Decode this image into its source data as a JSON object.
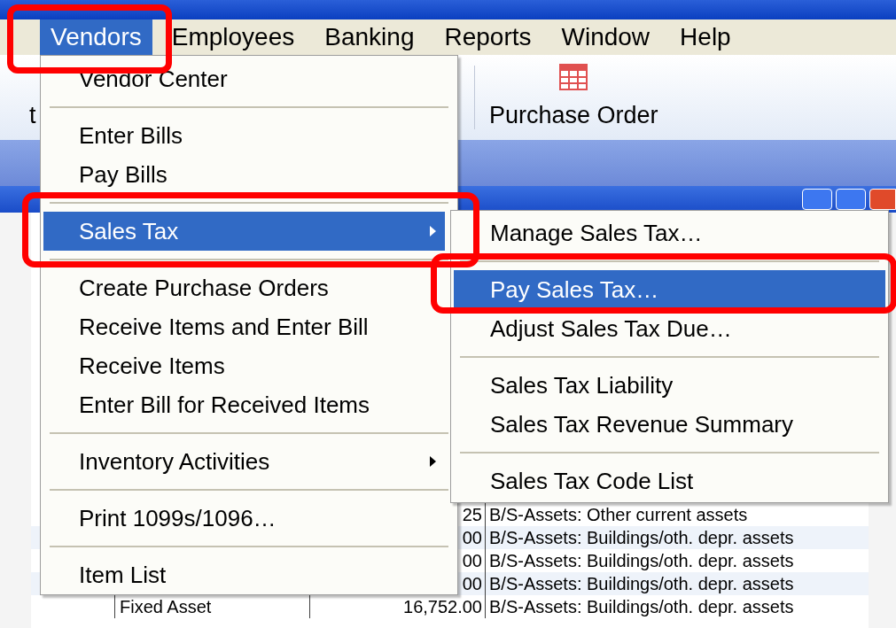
{
  "menu_bar": [
    {
      "label": "Vendors",
      "selected": true
    },
    {
      "label": "Employees",
      "selected": false
    },
    {
      "label": "Banking",
      "selected": false
    },
    {
      "label": "Reports",
      "selected": false
    },
    {
      "label": "Window",
      "selected": false
    },
    {
      "label": "Help",
      "selected": false
    }
  ],
  "toolbar": [
    {
      "label": "t",
      "kind": "text"
    },
    {
      "label": "Purchase Order",
      "kind": "icon"
    }
  ],
  "vendors_menu": [
    {
      "kind": "item",
      "label": "Vendor Center",
      "selected": false,
      "submenu": false
    },
    {
      "kind": "separator"
    },
    {
      "kind": "item",
      "label": "Enter Bills",
      "selected": false,
      "submenu": false
    },
    {
      "kind": "item",
      "label": "Pay Bills",
      "selected": false,
      "submenu": false
    },
    {
      "kind": "separator"
    },
    {
      "kind": "item",
      "label": "Sales Tax",
      "selected": true,
      "submenu": true
    },
    {
      "kind": "separator"
    },
    {
      "kind": "item",
      "label": "Create Purchase Orders",
      "selected": false,
      "submenu": false
    },
    {
      "kind": "item",
      "label": "Receive Items and Enter Bill",
      "selected": false,
      "submenu": false
    },
    {
      "kind": "item",
      "label": "Receive Items",
      "selected": false,
      "submenu": false
    },
    {
      "kind": "item",
      "label": "Enter Bill for Received Items",
      "selected": false,
      "submenu": false
    },
    {
      "kind": "separator"
    },
    {
      "kind": "item",
      "label": "Inventory Activities",
      "selected": false,
      "submenu": true
    },
    {
      "kind": "separator"
    },
    {
      "kind": "item",
      "label": "Print 1099s/1096…",
      "selected": false,
      "submenu": false
    },
    {
      "kind": "separator"
    },
    {
      "kind": "item",
      "label": "Item List",
      "selected": false,
      "submenu": false
    }
  ],
  "sales_tax_submenu": [
    {
      "kind": "item",
      "label": "Manage Sales Tax…",
      "selected": false,
      "submenu": false
    },
    {
      "kind": "separator"
    },
    {
      "kind": "item",
      "label": "Pay Sales Tax…",
      "selected": true,
      "submenu": false
    },
    {
      "kind": "item",
      "label": "Adjust Sales Tax Due…",
      "selected": false,
      "submenu": false
    },
    {
      "kind": "separator"
    },
    {
      "kind": "item",
      "label": "Sales Tax Liability",
      "selected": false,
      "submenu": false
    },
    {
      "kind": "item",
      "label": "Sales Tax Revenue Summary",
      "selected": false,
      "submenu": false
    },
    {
      "kind": "separator"
    },
    {
      "kind": "item",
      "label": "Sales Tax Code List",
      "selected": false,
      "submenu": false
    }
  ],
  "register_rows": [
    {
      "type": "",
      "amount": "25",
      "account": "B/S-Assets: Other current assets"
    },
    {
      "type": "",
      "amount": "00",
      "account": "B/S-Assets: Buildings/oth. depr. assets"
    },
    {
      "type": "",
      "amount": "00",
      "account": "B/S-Assets: Buildings/oth. depr. assets"
    },
    {
      "type": "",
      "amount": "00",
      "account": "B/S-Assets: Buildings/oth. depr. assets"
    },
    {
      "type": "Fixed Asset",
      "amount": "16,752.00",
      "account": "B/S-Assets: Buildings/oth. depr. assets"
    }
  ]
}
